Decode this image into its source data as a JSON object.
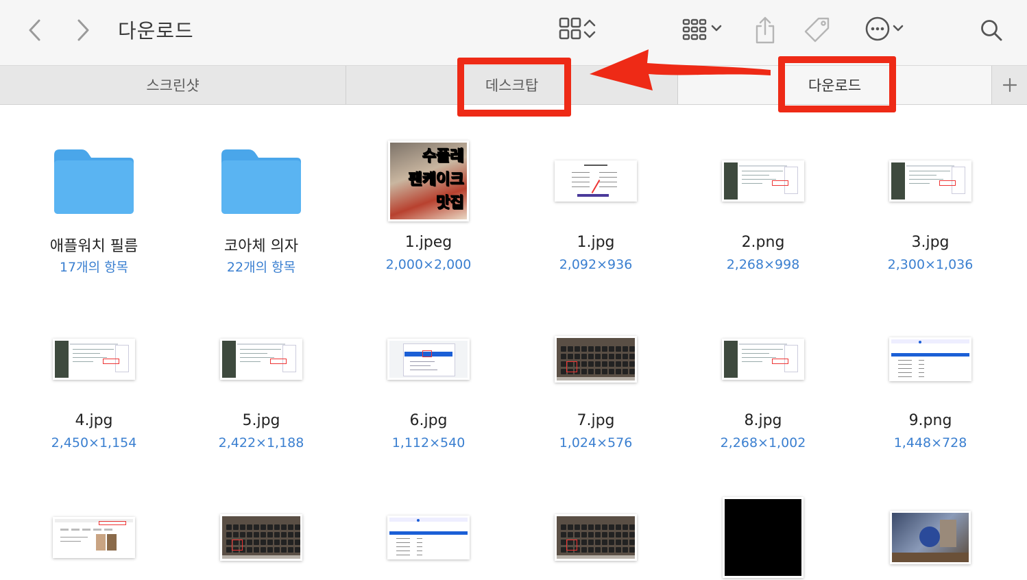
{
  "window": {
    "title": "다운로드"
  },
  "toolbar": {
    "back_icon": "chevron-left-icon",
    "forward_icon": "chevron-right-icon",
    "view_icon": "grid-view-icon",
    "group_icon": "group-by-icon",
    "share_icon": "share-icon",
    "tag_icon": "tag-icon",
    "more_icon": "ellipsis-circle-icon",
    "search_icon": "search-icon"
  },
  "tabs": [
    {
      "label": "스크린샷",
      "active": false
    },
    {
      "label": "데스크탑",
      "active": false
    },
    {
      "label": "다운로드",
      "active": true
    }
  ],
  "annotation": {
    "color": "#ee2a16"
  },
  "items": [
    {
      "name": "애플워치 필름",
      "meta": "17개의 항목",
      "kind": "folder"
    },
    {
      "name": "코아체 의자",
      "meta": "22개의 항목",
      "kind": "folder"
    },
    {
      "name": "1.jpeg",
      "meta": "2,000×2,000",
      "kind": "photo-food",
      "overlay": [
        "수플레",
        "팬케이크",
        "맛집"
      ]
    },
    {
      "name": "1.jpg",
      "meta": "2,092×936",
      "kind": "doc"
    },
    {
      "name": "2.png",
      "meta": "2,268×998",
      "kind": "screen"
    },
    {
      "name": "3.jpg",
      "meta": "2,300×1,036",
      "kind": "screen"
    },
    {
      "name": "4.jpg",
      "meta": "2,450×1,154",
      "kind": "screen"
    },
    {
      "name": "5.jpg",
      "meta": "2,422×1,188",
      "kind": "screen"
    },
    {
      "name": "6.jpg",
      "meta": "1,112×540",
      "kind": "screen-dialog"
    },
    {
      "name": "7.jpg",
      "meta": "1,024×576",
      "kind": "keyboard"
    },
    {
      "name": "8.jpg",
      "meta": "2,268×1,002",
      "kind": "screen"
    },
    {
      "name": "9.png",
      "meta": "1,448×728",
      "kind": "settings"
    },
    {
      "name": "",
      "meta": "",
      "kind": "web"
    },
    {
      "name": "",
      "meta": "",
      "kind": "keyboard"
    },
    {
      "name": "",
      "meta": "",
      "kind": "settings"
    },
    {
      "name": "",
      "meta": "",
      "kind": "keyboard"
    },
    {
      "name": "",
      "meta": "",
      "kind": "black"
    },
    {
      "name": "",
      "meta": "",
      "kind": "photo-work"
    }
  ],
  "colors": {
    "folder": "#5ab4f2",
    "link": "#3a7fd0",
    "accent_blue": "#1b5fd6"
  }
}
